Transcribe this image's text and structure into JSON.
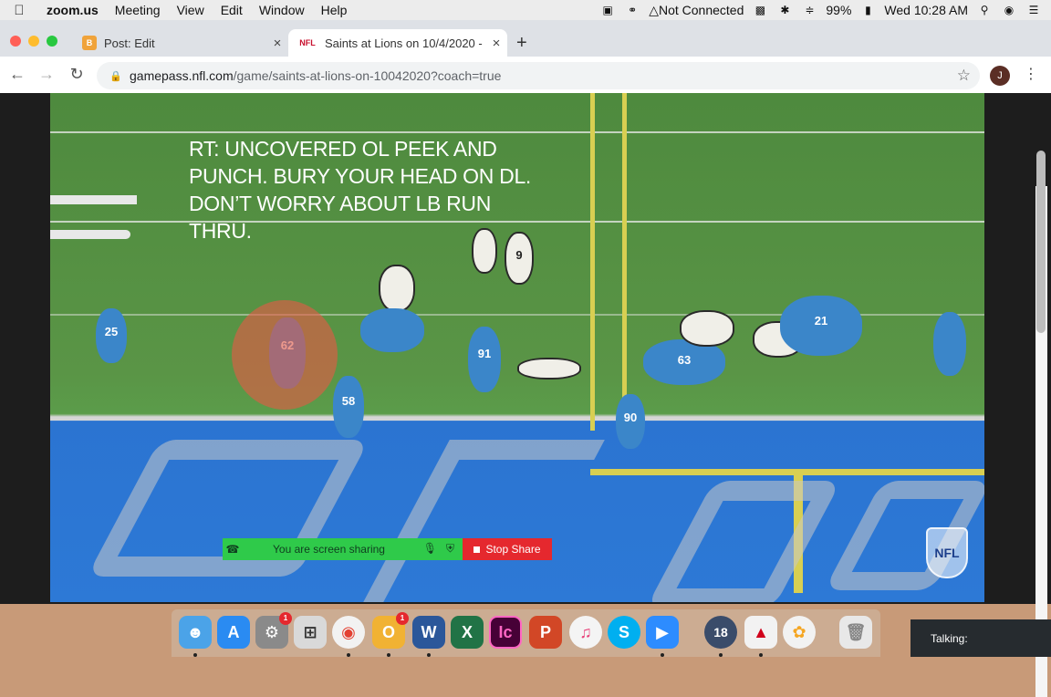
{
  "menubar": {
    "app": "zoom.us",
    "items": [
      "Meeting",
      "View",
      "Edit",
      "Window",
      "Help"
    ],
    "status": {
      "vpn_label": "Not Connected",
      "battery": "99%",
      "clock": "Wed 10:28 AM"
    }
  },
  "browser": {
    "tabs": [
      {
        "title": "Post: Edit",
        "favicon": "B",
        "favicon_color": "#f0a33a"
      },
      {
        "title": "Saints at Lions on 10/4/2020 -",
        "favicon": "NFL",
        "favicon_color": "#c8102e"
      }
    ],
    "url": {
      "host": "gamepass.nfl.com",
      "path": "/game/saints-at-lions-on-10042020?coach=true"
    },
    "profile_initial": "J"
  },
  "video": {
    "coach_note": "RT: UNCOVERED OL PEEK AND PUNCH. BURY YOUR HEAD ON DL. DON’T WORRY ABOUT LB RUN THRU.",
    "watermark": "NFL",
    "jersey_numbers": [
      "25",
      "9",
      "62",
      "58",
      "91",
      "63",
      "21",
      "90"
    ]
  },
  "screen_share": {
    "status": "You are screen sharing",
    "stop_label": "Stop Share",
    "green": "#2fca4a",
    "red": "#e5282e"
  },
  "dock": {
    "system_prefs_badge": "1",
    "outlook_badge": "1",
    "calendar_label": "18",
    "talking_label": "Talking:"
  }
}
